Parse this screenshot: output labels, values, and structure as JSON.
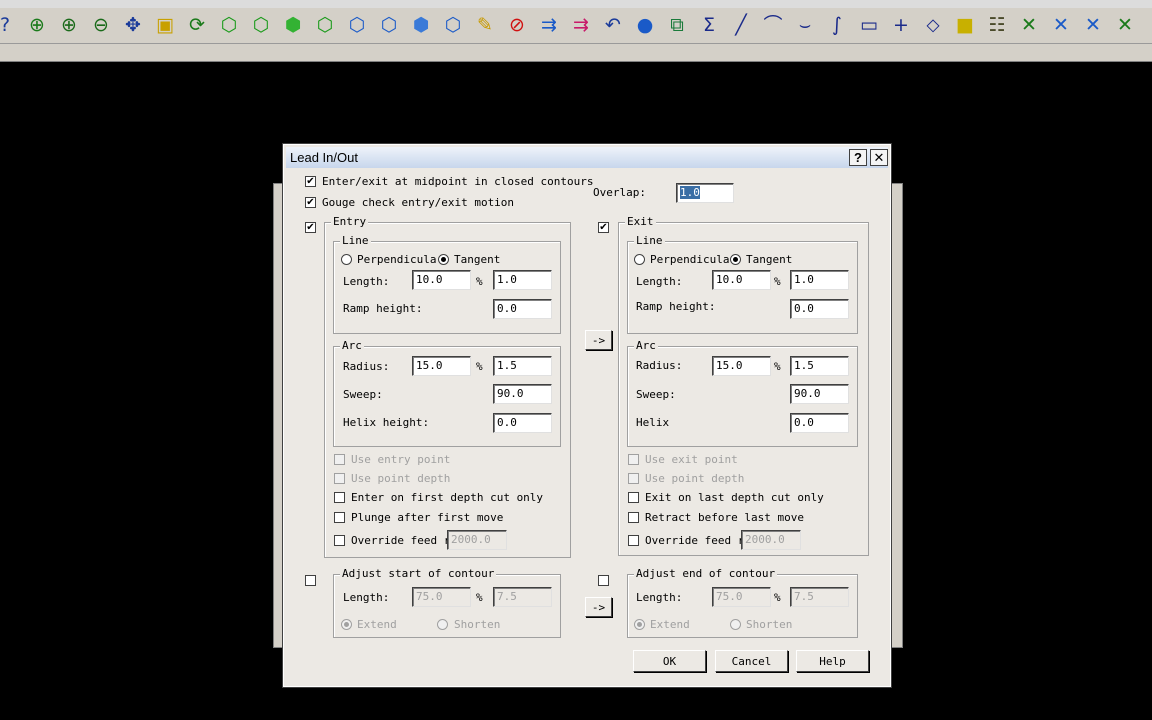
{
  "toolbar": {
    "icons": [
      {
        "name": "help-pointer-icon",
        "glyph": "?",
        "color": "#1a3a9a"
      },
      {
        "name": "zoom-window-icon",
        "glyph": "⊕",
        "color": "#1a7a1a"
      },
      {
        "name": "zoom-in-icon",
        "glyph": "⊕",
        "color": "#1a6a1a"
      },
      {
        "name": "zoom-out-icon",
        "glyph": "⊖",
        "color": "#1a6a1a"
      },
      {
        "name": "pan-icon",
        "glyph": "✥",
        "color": "#1a3a9a"
      },
      {
        "name": "zoom-select-icon",
        "glyph": "▣",
        "color": "#c8a000"
      },
      {
        "name": "rotate-view-icon",
        "glyph": "⟳",
        "color": "#1a7a1a"
      },
      {
        "name": "iso-view-icon",
        "glyph": "⬡",
        "color": "#1a9a1a"
      },
      {
        "name": "top-view-icon",
        "glyph": "⬡",
        "color": "#1a9a1a"
      },
      {
        "name": "front-view-icon",
        "glyph": "⬢",
        "color": "#33b233"
      },
      {
        "name": "side-view-icon",
        "glyph": "⬡",
        "color": "#1a9a1a"
      },
      {
        "name": "cube-view-1-icon",
        "glyph": "⬡",
        "color": "#1a5ac8"
      },
      {
        "name": "cube-view-2-icon",
        "glyph": "⬡",
        "color": "#1a5ac8"
      },
      {
        "name": "cube-view-3-icon",
        "glyph": "⬢",
        "color": "#3a7ad8"
      },
      {
        "name": "cube-view-4-icon",
        "glyph": "⬡",
        "color": "#1a5ac8"
      },
      {
        "name": "pencil-icon",
        "glyph": "✎",
        "color": "#c89a00"
      },
      {
        "name": "no-draw-icon",
        "glyph": "⊘",
        "color": "#d01010"
      },
      {
        "name": "transform-1-icon",
        "glyph": "⇉",
        "color": "#1a5ac8"
      },
      {
        "name": "transform-2-icon",
        "glyph": "⇉",
        "color": "#c81a6a"
      },
      {
        "name": "undo-icon",
        "glyph": "↶",
        "color": "#1a3a9a"
      },
      {
        "name": "sphere-icon",
        "glyph": "●",
        "color": "#1a5ac8"
      },
      {
        "name": "group-icon",
        "glyph": "⧉",
        "color": "#1a7a3a"
      },
      {
        "name": "sum-icon",
        "glyph": "Σ",
        "color": "#1a2a8a"
      },
      {
        "name": "line-icon",
        "glyph": "╱",
        "color": "#1a2a8a"
      },
      {
        "name": "arc-icon",
        "glyph": "⌒",
        "color": "#1a2a8a"
      },
      {
        "name": "fillet-icon",
        "glyph": "⌣",
        "color": "#1a2a8a"
      },
      {
        "name": "spline-icon",
        "glyph": "∫",
        "color": "#1a2a8a"
      },
      {
        "name": "rectangle-icon",
        "glyph": "▭",
        "color": "#1a2a8a"
      },
      {
        "name": "point-icon",
        "glyph": "+",
        "color": "#1a2a8a"
      },
      {
        "name": "plane-icon",
        "glyph": "⬦",
        "color": "#1a2a8a"
      },
      {
        "name": "solid-icon",
        "glyph": "■",
        "color": "#c8b000"
      },
      {
        "name": "layers-icon",
        "glyph": "☷",
        "color": "#4a4a2a"
      },
      {
        "name": "trim-1-icon",
        "glyph": "✕",
        "color": "#1a7a1a"
      },
      {
        "name": "trim-2-icon",
        "glyph": "✕",
        "color": "#1a5ac8"
      },
      {
        "name": "trim-3-icon",
        "glyph": "✕",
        "color": "#1a5ac8"
      },
      {
        "name": "trim-4-icon",
        "glyph": "✕",
        "color": "#1a7a1a"
      }
    ]
  },
  "dialog": {
    "title": "Lead In/Out",
    "help_button": "?",
    "close_button": "✕",
    "midpoint_label": "Enter/exit at midpoint in closed contours",
    "midpoint_checked": true,
    "gouge_label": "Gouge check entry/exit motion",
    "gouge_checked": true,
    "overlap_label": "Overlap:",
    "overlap_value": "1.0",
    "copy_arrow": "->",
    "entry": {
      "title": "Entry",
      "enabled": true,
      "line_title": "Line",
      "perp_label": "Perpendicula",
      "tangent_label": "Tangent",
      "mode": "tangent",
      "length_label": "Length:",
      "length_value": "10.0",
      "percent": "%",
      "length_pct": "1.0",
      "ramp_label": "Ramp height:",
      "ramp_value": "0.0",
      "arc_title": "Arc",
      "radius_label": "Radius:",
      "radius_value": "15.0",
      "radius_pct": "1.5",
      "sweep_label": "Sweep:",
      "sweep_value": "90.0",
      "helix_label": "Helix height:",
      "helix_value": "0.0",
      "use_point_label": "Use entry point",
      "use_depth_label": "Use point depth",
      "first_depth_label": "Enter on first depth cut only",
      "plunge_label": "Plunge after first move",
      "override_label": "Override feed ra",
      "override_value": "2000.0"
    },
    "exit": {
      "title": "Exit",
      "enabled": true,
      "line_title": "Line",
      "perp_label": "Perpendicula",
      "tangent_label": "Tangent",
      "mode": "tangent",
      "length_label": "Length:",
      "length_value": "10.0",
      "percent": "%",
      "length_pct": "1.0",
      "ramp_label": "Ramp height:",
      "ramp_value": "0.0",
      "arc_title": "Arc",
      "radius_label": "Radius:",
      "radius_value": "15.0",
      "radius_pct": "1.5",
      "sweep_label": "Sweep:",
      "sweep_value": "90.0",
      "helix_label": "Helix",
      "helix_value": "0.0",
      "use_point_label": "Use exit point",
      "use_depth_label": "Use point depth",
      "last_depth_label": "Exit on last depth cut only",
      "retract_label": "Retract before last move",
      "override_label": "Override feed ra",
      "override_value": "2000.0"
    },
    "adjust_start": {
      "title": "Adjust start of contour",
      "length_label": "Length:",
      "length_value": "75.0",
      "percent": "%",
      "length_pct": "7.5",
      "extend_label": "Extend",
      "shorten_label": "Shorten"
    },
    "adjust_end": {
      "title": "Adjust end of contour",
      "length_label": "Length:",
      "length_value": "75.0",
      "percent": "%",
      "length_pct": "7.5",
      "extend_label": "Extend",
      "shorten_label": "Shorten"
    },
    "ok_label": "OK",
    "cancel_label": "Cancel",
    "help_label": "Help"
  }
}
